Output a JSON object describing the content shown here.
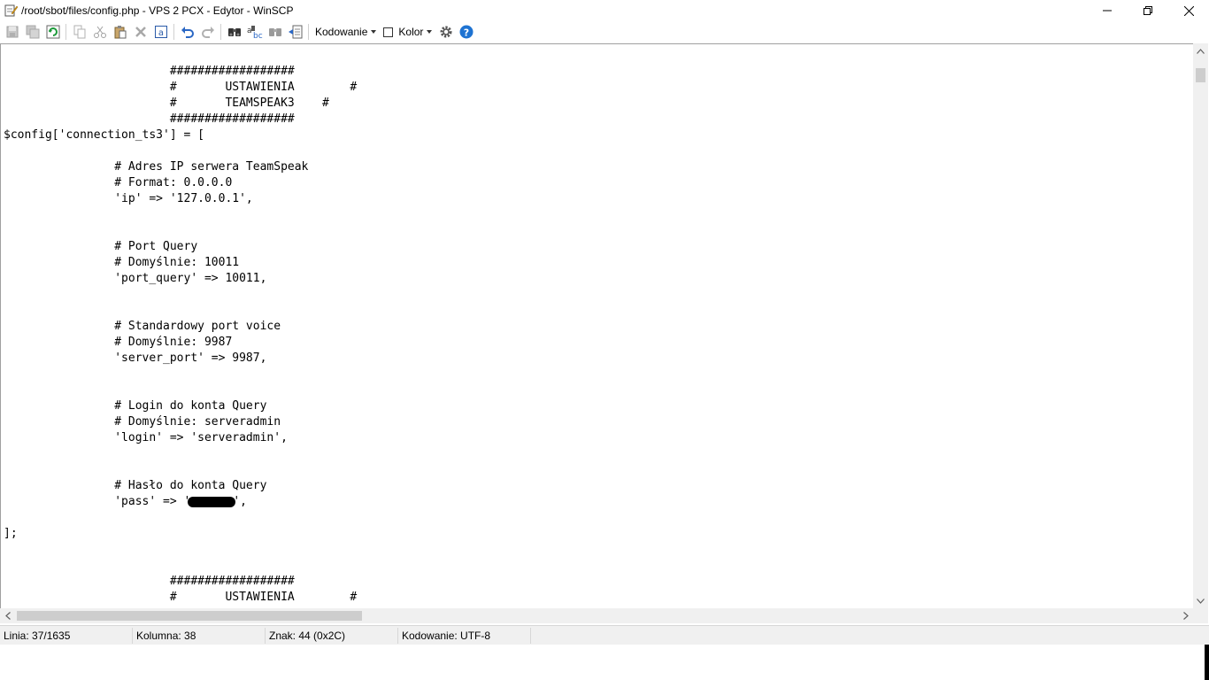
{
  "window": {
    "title": "/root/sbot/files/config.php - VPS 2 PCX - Edytor - WinSCP"
  },
  "toolbar": {
    "encoding_label": "Kodowanie",
    "color_label": "Kolor",
    "color_checked": false
  },
  "editor": {
    "lines": [
      "                        ##################",
      "                        #       USTAWIENIA        #",
      "                        #       TEAMSPEAK3    #",
      "                        ##################",
      "$config['connection_ts3'] = [",
      "",
      "                # Adres IP serwera TeamSpeak",
      "                # Format: 0.0.0.0",
      "                'ip' => '127.0.0.1',",
      "",
      "",
      "                # Port Query",
      "                # Domyślnie: 10011",
      "                'port_query' => 10011,",
      "",
      "",
      "                # Standardowy port voice",
      "                # Domyślnie: 9987",
      "                'server_port' => 9987,",
      "",
      "",
      "                # Login do konta Query",
      "                # Domyślnie: serveradmin",
      "                'login' => 'serveradmin',",
      "",
      "",
      "                # Hasło do konta Query",
      "                'pass' => '",
      "",
      "];",
      "",
      "",
      "                        ##################",
      "                        #       USTAWIENIA        #"
    ],
    "pass_line_index": 27,
    "pass_suffix": "',"
  },
  "statusbar": {
    "line": "Linia: 37/1635",
    "column": "Kolumna: 38",
    "char": "Znak: 44 (0x2C)",
    "encoding": "Kodowanie: UTF-8"
  },
  "colors": {
    "help_blue": "#1e73d2",
    "undo_blue": "#2a67c4"
  }
}
